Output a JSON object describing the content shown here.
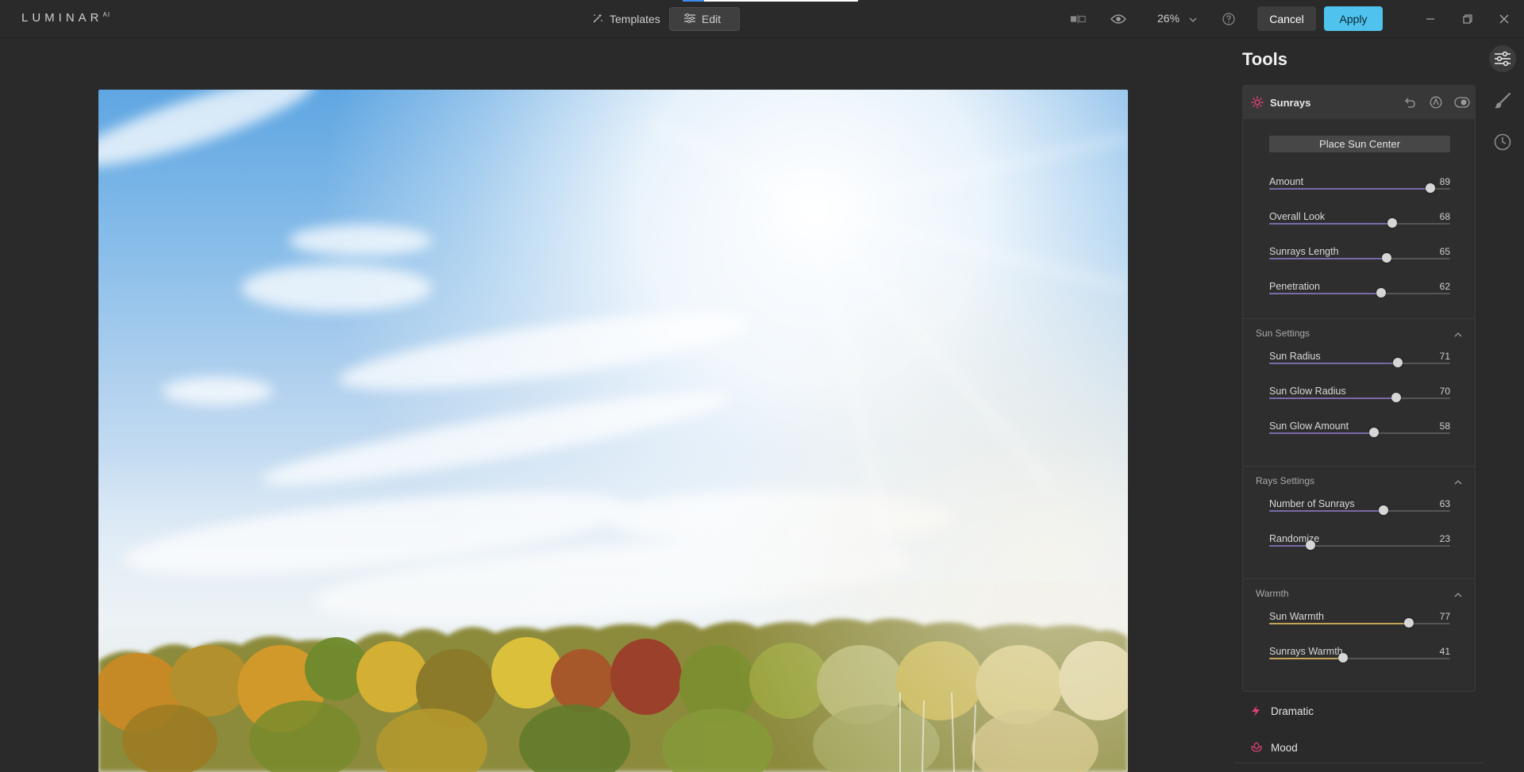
{
  "app": {
    "logo": "LUMINAR",
    "logo_suffix": "AI"
  },
  "topbar": {
    "tabs": {
      "templates": "Templates",
      "edit": "Edit"
    },
    "zoom": "26%",
    "cancel_label": "Cancel",
    "apply_label": "Apply"
  },
  "tools_panel": {
    "title": "Tools",
    "active_tool": {
      "name": "Sunrays",
      "icon": "sun-icon",
      "icon_color": "#e0407a",
      "place_button": "Place Sun Center",
      "main_sliders": [
        {
          "label": "Amount",
          "value": 89
        },
        {
          "label": "Overall Look",
          "value": 68
        },
        {
          "label": "Sunrays Length",
          "value": 65
        },
        {
          "label": "Penetration",
          "value": 62
        }
      ],
      "sections": [
        {
          "title": "Sun Settings",
          "sliders": [
            {
              "label": "Sun Radius",
              "value": 71
            },
            {
              "label": "Sun Glow Radius",
              "value": 70
            },
            {
              "label": "Sun Glow Amount",
              "value": 58
            }
          ]
        },
        {
          "title": "Rays Settings",
          "sliders": [
            {
              "label": "Number of Sunrays",
              "value": 63
            },
            {
              "label": "Randomize",
              "value": 23
            }
          ]
        },
        {
          "title": "Warmth",
          "sliders": [
            {
              "label": "Sun Warmth",
              "value": 77
            },
            {
              "label": "Sunrays Warmth",
              "value": 41
            }
          ]
        }
      ]
    },
    "other_tools": [
      {
        "name": "Dramatic",
        "icon": "lightning-icon"
      },
      {
        "name": "Mood",
        "icon": "flower-icon"
      }
    ]
  },
  "colors": {
    "accent": "#4fc3ee",
    "slider_fill": "#7a6aa8",
    "warmth_fill": "#c2a55a",
    "background": "#2a2a2a"
  }
}
